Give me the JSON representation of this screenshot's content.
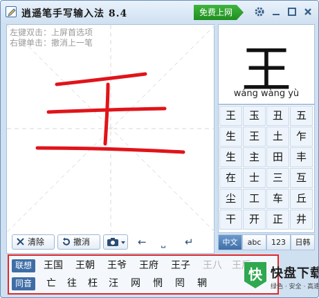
{
  "window": {
    "title": "逍遥笔手写输入法 8.4",
    "free_net_label": "免费上网"
  },
  "write_area": {
    "hint_line1": "左键双击：上屏首选项",
    "hint_line2": "右键单击：撤消上一笔",
    "ink_color": "#e0141a"
  },
  "toolbar": {
    "clear_label": "清除",
    "undo_label": "撤消",
    "left_arrow": "←",
    "space_glyph": "⎵",
    "enter_glyph": "↵"
  },
  "preview": {
    "char": "王",
    "pinyin": "wáng wàng yù"
  },
  "candidates_grid": [
    [
      "王",
      "玉",
      "丑",
      "五"
    ],
    [
      "生",
      "王",
      "土",
      "乍"
    ],
    [
      "生",
      "主",
      "田",
      "丰"
    ],
    [
      "在",
      "士",
      "三",
      "互"
    ],
    [
      "尘",
      "工",
      "车",
      "丘"
    ],
    [
      "干",
      "开",
      "正",
      "井"
    ]
  ],
  "modes": [
    "中文",
    "abc",
    "123",
    "日韩"
  ],
  "active_mode": "中文",
  "association": {
    "tag": "联想",
    "items": [
      "王国",
      "王朝",
      "王爷",
      "王府",
      "王子"
    ],
    "faded_items": [
      "王八",
      "王后"
    ]
  },
  "homophone": {
    "tag": "同音",
    "items": [
      "亡",
      "往",
      "枉",
      "汪",
      "网",
      "惘",
      "罔",
      "辋"
    ]
  },
  "watermark": {
    "title": "快盘下载",
    "subtitle": "绿色 · 安全 · 高速"
  },
  "colors": {
    "accent": "#3f6ea6",
    "free_net": "#2a9d2a",
    "highlight_border": "#e0282b"
  }
}
